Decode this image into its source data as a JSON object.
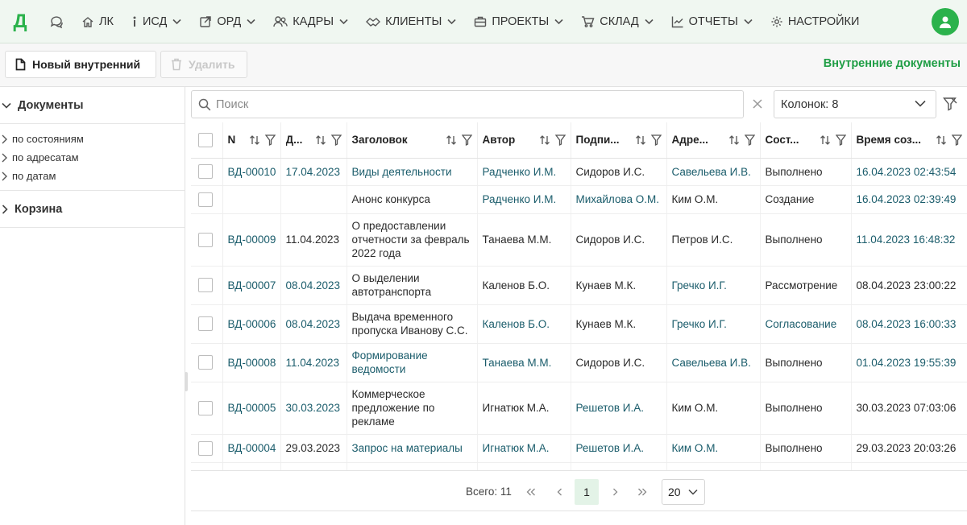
{
  "colors": {
    "accent": "#2bb24c",
    "heading": "#1f9e45",
    "link": "#1a5c6b"
  },
  "nav": {
    "logo": "Д",
    "items": [
      {
        "key": "lk",
        "icon": "home-icon",
        "label": "ЛК",
        "dropdown": false
      },
      {
        "key": "isd",
        "icon": "info-icon",
        "label": "ИСД",
        "dropdown": true
      },
      {
        "key": "ord",
        "icon": "external-link-icon",
        "label": "ОРД",
        "dropdown": true
      },
      {
        "key": "kadry",
        "icon": "users-icon",
        "label": "КАДРЫ",
        "dropdown": true
      },
      {
        "key": "klienty",
        "icon": "handshake-icon",
        "label": "КЛИЕНТЫ",
        "dropdown": true
      },
      {
        "key": "proekty",
        "icon": "briefcase-icon",
        "label": "ПРОЕКТЫ",
        "dropdown": true
      },
      {
        "key": "sklad",
        "icon": "cart-icon",
        "label": "СКЛАД",
        "dropdown": true
      },
      {
        "key": "otchety",
        "icon": "chart-line-icon",
        "label": "ОТЧЕТЫ",
        "dropdown": true
      },
      {
        "key": "nastroyki",
        "icon": "gear-icon",
        "label": "НАСТРОЙКИ",
        "dropdown": false
      }
    ]
  },
  "toolbar": {
    "new_label": "Новый внутренний",
    "delete_label": "Удалить",
    "page_title": "Внутренние документы"
  },
  "sidebar": {
    "documents": "Документы",
    "sub": [
      "по состояниям",
      "по адресатам",
      "по датам"
    ],
    "trash": "Корзина"
  },
  "search": {
    "placeholder": "Поиск"
  },
  "columns_select": {
    "value": "Колонок: 8"
  },
  "table": {
    "headers": [
      "N",
      "Д...",
      "Заголовок",
      "Автор",
      "Подпи...",
      "Адре...",
      "Сост...",
      "Время соз..."
    ],
    "rows": [
      [
        "ВД-00010",
        "17.04.2023",
        "Виды деятельности",
        "Радченко И.М.",
        "Сидоров И.С.",
        "Савельева И.В.",
        "Выполнено",
        "16.04.2023 02:43:54"
      ],
      [
        "",
        "",
        "Анонс конкурса",
        "Радченко И.М.",
        "Михайлова О.М.",
        "Ким О.М.",
        "Создание",
        "16.04.2023 02:39:49"
      ],
      [
        "ВД-00009",
        "11.04.2023",
        "О предоставлении отчетности за февраль 2022 года",
        "Танаева М.М.",
        "Сидоров И.С.",
        "Петров И.С.",
        "Выполнено",
        "11.04.2023 16:48:32"
      ],
      [
        "ВД-00007",
        "08.04.2023",
        "О выделении автотранспорта",
        "Каленов Б.О.",
        "Кунаев М.К.",
        "Гречко И.Г.",
        "Рассмотрение",
        "08.04.2023 23:00:22"
      ],
      [
        "ВД-00006",
        "08.04.2023",
        "Выдача временного пропуска Иванову С.С.",
        "Каленов Б.О.",
        "Кунаев М.К.",
        "Гречко И.Г.",
        "Согласование",
        "08.04.2023 16:00:33"
      ],
      [
        "ВД-00008",
        "11.04.2023",
        "Формирование ведомости",
        "Танаева М.М.",
        "Сидоров И.С.",
        "Савельева И.В.",
        "Выполнено",
        "01.04.2023 19:55:39"
      ],
      [
        "ВД-00005",
        "30.03.2023",
        "Коммерческое предложение по рекламе",
        "Игнатюк М.А.",
        "Решетов И.А.",
        "Ким О.М.",
        "Выполнено",
        "30.03.2023 07:03:06"
      ],
      [
        "ВД-00004",
        "29.03.2023",
        "Запрос на материалы",
        "Игнатюк М.А.",
        "Решетов И.А.",
        "Ким О.М.",
        "Выполнено",
        "29.03.2023 20:03:26"
      ]
    ]
  },
  "pager": {
    "total": "Всего: 11",
    "current_page": "1",
    "page_size": "20"
  }
}
